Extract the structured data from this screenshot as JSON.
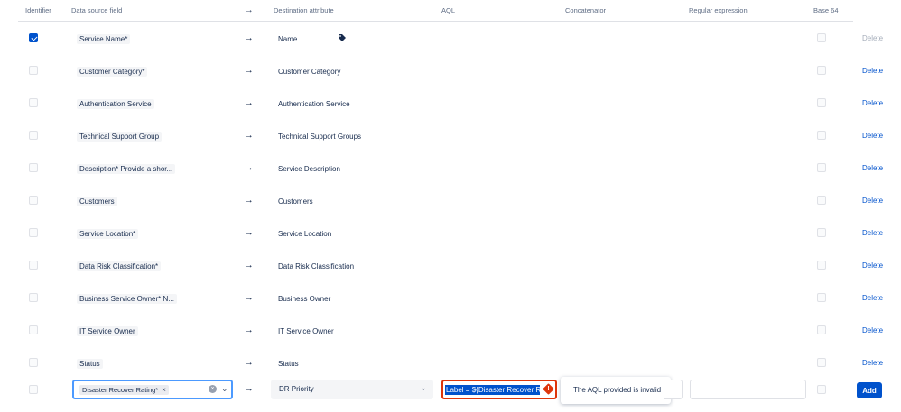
{
  "header": {
    "identifier": "Identifier",
    "data_source_field": "Data source field",
    "arrow": "→",
    "destination_attribute": "Destination attribute",
    "aql": "AQL",
    "concatenator": "Concatenator",
    "regular_expression": "Regular expression",
    "base64": "Base 64"
  },
  "rows": [
    {
      "identifier_checked": true,
      "source": "Service Name*",
      "destination": "Name",
      "delete_label": "Delete",
      "delete_enabled": false
    },
    {
      "identifier_checked": false,
      "source": "Customer Category*",
      "destination": "Customer Category",
      "delete_label": "Delete",
      "delete_enabled": true
    },
    {
      "identifier_checked": false,
      "source": "Authentication Service",
      "destination": "Authentication Service",
      "delete_label": "Delete",
      "delete_enabled": true
    },
    {
      "identifier_checked": false,
      "source": "Technical Support Group",
      "destination": "Technical Support Groups",
      "delete_label": "Delete",
      "delete_enabled": true
    },
    {
      "identifier_checked": false,
      "source": "Description* Provide a shor...",
      "destination": "Service Description",
      "delete_label": "Delete",
      "delete_enabled": true
    },
    {
      "identifier_checked": false,
      "source": "Customers",
      "destination": "Customers",
      "delete_label": "Delete",
      "delete_enabled": true
    },
    {
      "identifier_checked": false,
      "source": "Service Location*",
      "destination": "Service Location",
      "delete_label": "Delete",
      "delete_enabled": true
    },
    {
      "identifier_checked": false,
      "source": "Data Risk Classification*",
      "destination": "Data Risk Classification",
      "delete_label": "Delete",
      "delete_enabled": true
    },
    {
      "identifier_checked": false,
      "source": "Business Service Owner* N...",
      "destination": "Business Owner",
      "delete_label": "Delete",
      "delete_enabled": true
    },
    {
      "identifier_checked": false,
      "source": "IT Service Owner",
      "destination": "IT Service Owner",
      "delete_label": "Delete",
      "delete_enabled": true
    },
    {
      "identifier_checked": false,
      "source": "Status",
      "destination": "Status",
      "delete_label": "Delete",
      "delete_enabled": true
    }
  ],
  "new_row": {
    "source_chip": "Disaster Recover Rating*",
    "chip_remove": "×",
    "clear_glyph": "×",
    "chevron_glyph": "⌄",
    "arrow": "→",
    "destination": "DR Priority",
    "aql_value": "Label = ${Disaster Recover Rat",
    "aql_error_glyph": "!",
    "aql_error_message": "The AQL provided is invalid",
    "add_label": "Add"
  },
  "icons": {
    "tag": "tag-icon",
    "arrow": "arrow-right-icon",
    "clear": "clear-icon",
    "chevron": "chevron-down-icon",
    "error": "error-icon"
  },
  "colors": {
    "primary": "#0052cc",
    "error": "#de350b",
    "focus": "#4c9aff",
    "disabled_text": "#a5adba"
  }
}
